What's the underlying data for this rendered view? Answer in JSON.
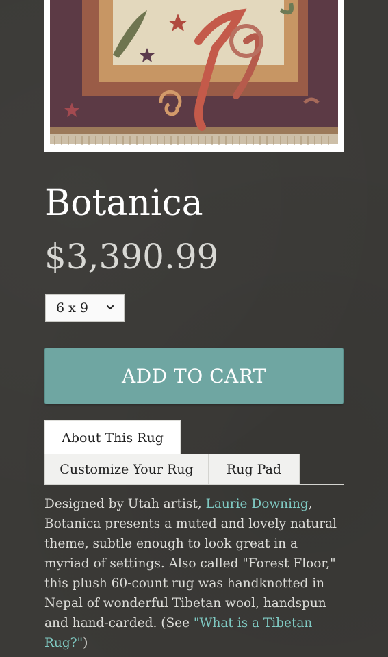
{
  "product": {
    "title": "Botanica",
    "price": "$3,390.99",
    "image_alt": "Botanica rug"
  },
  "size_select": {
    "selected": "6 x 9"
  },
  "cart": {
    "add_label": "ADD TO CART"
  },
  "tabs": [
    {
      "label": "About This Rug",
      "active": true
    },
    {
      "label": "Customize Your Rug",
      "active": false
    },
    {
      "label": "Rug Pad",
      "active": false
    }
  ],
  "description": {
    "part1": "Designed by Utah artist, ",
    "artist_link": "Laurie Downing",
    "part2": ", Botanica presents a muted and lovely natural theme, subtle enough to look great in a myriad of settings. Also called \"Forest Floor,\" this plush 60-count rug was handknotted in Nepal of wonderful Tibetan wool, handspun and hand-carded. (See ",
    "tibetan_link": "\"What is a Tibetan Rug?\"",
    "part3": ")"
  },
  "colors": {
    "background": "#3b3a37",
    "accent": "#6fa6a2",
    "link": "#7fc9c2"
  }
}
